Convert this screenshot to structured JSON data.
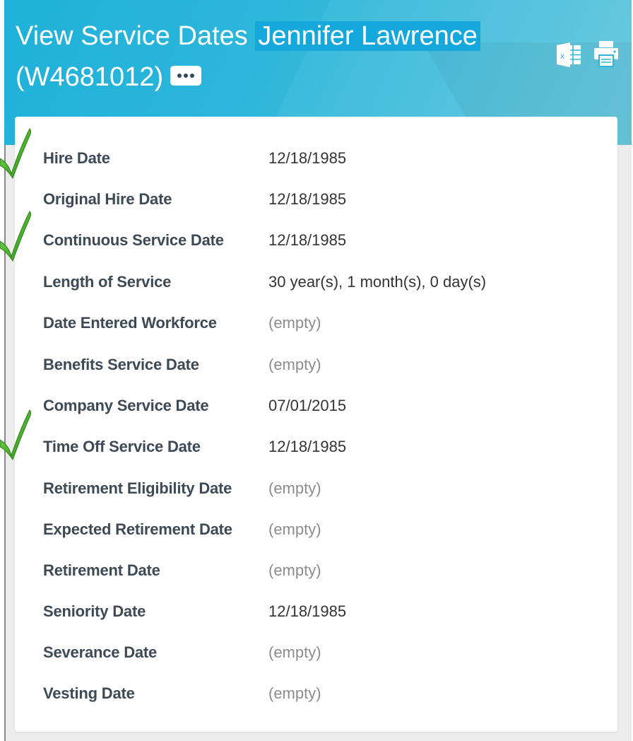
{
  "header": {
    "title_prefix": "View Service Dates",
    "worker_name": "Jennifer Lawrence",
    "worker_id": "(W4681012)",
    "more_icon": "ellipsis-icon",
    "excel_icon": "excel-export-icon",
    "print_icon": "print-icon"
  },
  "fields": [
    {
      "label": "Hire Date",
      "value": "12/18/1985"
    },
    {
      "label": "Original Hire Date",
      "value": "12/18/1985"
    },
    {
      "label": "Continuous Service Date",
      "value": "12/18/1985"
    },
    {
      "label": "Length of Service",
      "value": "30 year(s), 1 month(s), 0 day(s)"
    },
    {
      "label": "Date Entered Workforce",
      "value": "(empty)"
    },
    {
      "label": "Benefits Service Date",
      "value": "(empty)"
    },
    {
      "label": "Company Service Date",
      "value": "07/01/2015"
    },
    {
      "label": "Time Off Service Date",
      "value": "12/18/1985"
    },
    {
      "label": "Retirement Eligibility Date",
      "value": "(empty)"
    },
    {
      "label": "Expected Retirement Date",
      "value": "(empty)"
    },
    {
      "label": "Retirement Date",
      "value": "(empty)"
    },
    {
      "label": "Seniority Date",
      "value": "12/18/1985"
    },
    {
      "label": "Severance Date",
      "value": "(empty)"
    },
    {
      "label": "Vesting Date",
      "value": "(empty)"
    }
  ],
  "colors": {
    "header": "#2cb6db",
    "highlight": "#14a8dc",
    "label": "#3d4a55",
    "empty_value": "#8c8c8c",
    "checkmark": "#4fb82f"
  }
}
